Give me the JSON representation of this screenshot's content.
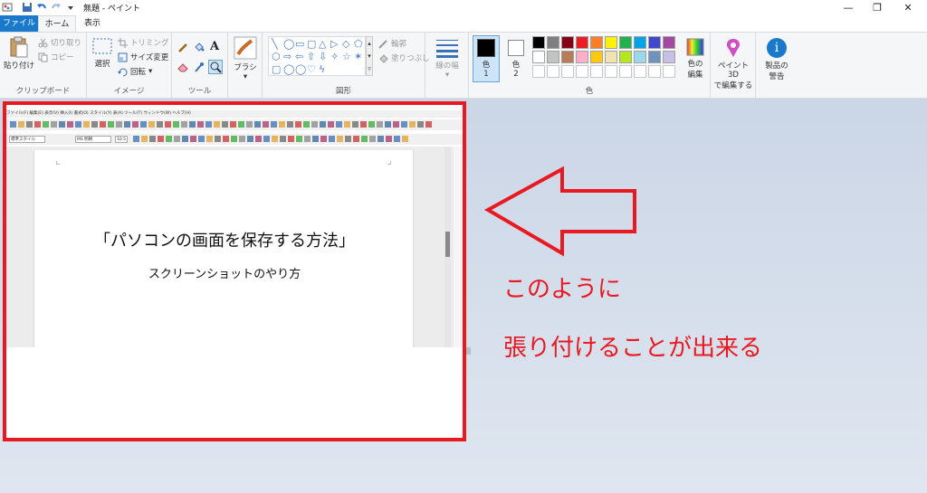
{
  "window": {
    "title": "無題 - ペイント",
    "min_glyph": "—",
    "restore_glyph": "❐",
    "close_glyph": "✕"
  },
  "tabs": {
    "file": "ファイル",
    "home": "ホーム",
    "view": "表示"
  },
  "ribbon": {
    "clipboard": {
      "paste": "貼り付け",
      "cut": "切り取り",
      "copy": "コピー",
      "label": "クリップボード"
    },
    "image": {
      "select": "選択",
      "crop": "トリミング",
      "resize": "サイズ変更",
      "rotate": "回転",
      "label": "イメージ"
    },
    "tools": {
      "label": "ツール",
      "text_tool": "A"
    },
    "brushes": {
      "label": "ブラシ"
    },
    "shapes": {
      "outline": "輪郭",
      "fill": "塗りつぶし",
      "label": "図形",
      "glyphs": [
        "╲",
        "◯",
        "▭",
        "▢",
        "△",
        "▷",
        "◇",
        "⬠",
        "⬡",
        "⇨",
        "⇦",
        "⇧",
        "⇩",
        "✧",
        "☆",
        "✶",
        "▢",
        "◯",
        "◯",
        "♡",
        "ϟ"
      ]
    },
    "size": {
      "label": "線の幅"
    },
    "colors": {
      "color1": "色",
      "color1_num": "1",
      "color2": "色",
      "color2_num": "2",
      "edit": "色の",
      "edit2": "編集",
      "label": "色",
      "color1_value": "#000000",
      "color2_value": "#ffffff",
      "palette": [
        "#000000",
        "#7f7f7f",
        "#880015",
        "#ed1c24",
        "#ff7f27",
        "#fff200",
        "#22b14c",
        "#00a2e8",
        "#3f48cc",
        "#a349a4",
        "#ffffff",
        "#c3c3c3",
        "#b97a57",
        "#ffaec9",
        "#ffc90e",
        "#efe4b0",
        "#b5e61d",
        "#99d9ea",
        "#7092be",
        "#c8bfe7"
      ]
    },
    "paint3d": {
      "line1": "ペイント 3D",
      "line2": "で編集する"
    },
    "product": {
      "line1": "製品の",
      "line2": "警告",
      "glyph": "i"
    }
  },
  "pasted_document": {
    "title": "「パソコンの画面を保存する方法」",
    "subtitle": "スクリーンショットのやり方",
    "menu": [
      "ファイル(F)",
      "編集(E)",
      "表示(V)",
      "挿入(I)",
      "書式(O)",
      "スタイル(Y)",
      "表(A)",
      "ツール(T)",
      "ウィンドウ(W)",
      "ヘルプ(H)"
    ],
    "style_box": "標準スタイル",
    "font_box": "MS 明朝",
    "size_box": "10.5"
  },
  "annotation": {
    "line1": "このように",
    "line2": "張り付けることが出来る",
    "color": "#e81921"
  }
}
